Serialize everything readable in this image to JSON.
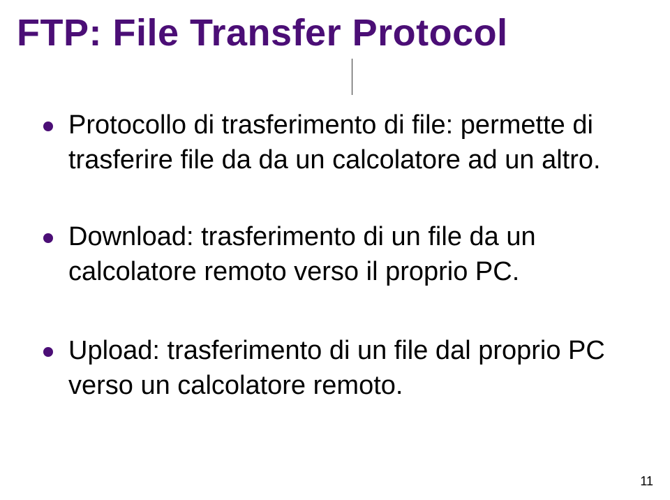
{
  "title": "FTP: File Transfer Protocol",
  "bullets": [
    {
      "text": "Protocollo di trasferimento di file: permette di trasferire file da da un calcolatore ad un altro."
    },
    {
      "text": "Download: trasferimento di un file da un calcolatore remoto verso il proprio PC."
    },
    {
      "text": "Upload: trasferimento di un file dal proprio PC verso un calcolatore remoto."
    }
  ],
  "pageNumber": "11"
}
